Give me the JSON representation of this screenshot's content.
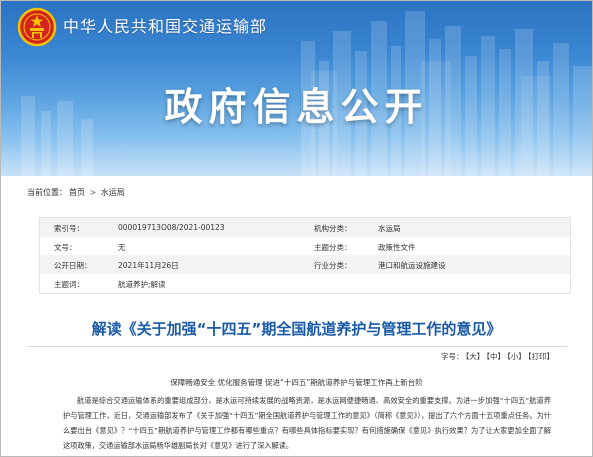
{
  "header": {
    "site_name": "中华人民共和国交通运输部",
    "section_title": "政府信息公开"
  },
  "breadcrumb": {
    "prefix": "当前位置：",
    "items": [
      "首页",
      "水运局"
    ],
    "separator": ">"
  },
  "meta": {
    "rows": [
      {
        "label1": "索引号：",
        "value1": "000019713O08/2021-00123",
        "label2": "机构分类：",
        "value2": "水运局"
      },
      {
        "label1": "文号：",
        "value1": "无",
        "label2": "主题分类：",
        "value2": "政策性文件"
      },
      {
        "label1": "公开日期：",
        "value1": "2021年11月26日",
        "label2": "行业分类：",
        "value2": "港口和航运设施建设"
      },
      {
        "label1": "主题词：",
        "value1": "航道养护;解读",
        "label2": "",
        "value2": ""
      }
    ]
  },
  "article": {
    "title": "解读《关于加强“十四五”期全国航道养护与管理工作的意见》",
    "font_size_label": "字号：",
    "font_size_options": [
      "【大】",
      "【中】",
      "【小】",
      "【打印】"
    ],
    "subtitle": "保障畅通安全 优化服务管理 促进“十四五”期航道养护与管理工作再上新台阶",
    "paragraph": "航道是综合交通运输体系的重要组成部分，是水运可持续发展的战略资源，是水运网便捷畅通、高效安全的重要支撑。为进一步加强“十四五”航道养护与管理工作，近日，交通运输部发布了《关于加强“十四五”期全国航道养护与管理工作的意见》（简称《意见》），提出了六个方面十五项重点任务。为什么要出台《意见》？“十四五”期航道养护与管理工作都有哪些重点？有哪些具体指标要实现？有何措施确保《意见》执行效果？为了让大家更加全面了解这项政策，交通运输部水运局杨华雄副局长对《意见》进行了深入解读。"
  },
  "colors": {
    "banner_top": "#2b73c2",
    "banner_bottom": "#c9e2f7",
    "title_blue": "#1a5aa6",
    "emblem_red": "#d4231c",
    "emblem_gold": "#f5c400"
  }
}
